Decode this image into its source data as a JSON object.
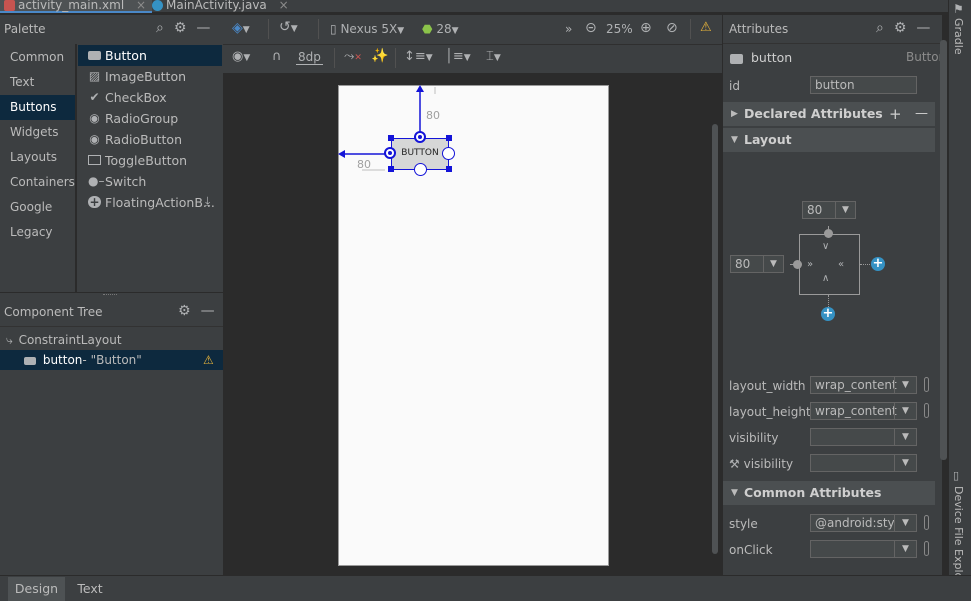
{
  "tabs": [
    {
      "label": "activity_main.xml",
      "close": "×"
    },
    {
      "label": "MainActivity.java",
      "close": "×"
    }
  ],
  "palette": {
    "title": "Palette",
    "categories": [
      "Common",
      "Text",
      "Buttons",
      "Widgets",
      "Layouts",
      "Containers",
      "Google",
      "Legacy"
    ],
    "selected_category": "Buttons",
    "widgets": [
      {
        "label": "Button",
        "icon": "button-icon"
      },
      {
        "label": "ImageButton",
        "icon": "image-icon"
      },
      {
        "label": "CheckBox",
        "icon": "check-icon"
      },
      {
        "label": "RadioGroup",
        "icon": "radio-icon"
      },
      {
        "label": "RadioButton",
        "icon": "radio-icon"
      },
      {
        "label": "ToggleButton",
        "icon": "toggle-icon"
      },
      {
        "label": "Switch",
        "icon": "switch-icon"
      },
      {
        "label": "FloatingActionB...",
        "icon": "fab-icon"
      }
    ]
  },
  "component_tree": {
    "title": "Component Tree",
    "root": "ConstraintLayout",
    "child_name": "button",
    "child_text": "- \"Button\""
  },
  "toolbar": {
    "device": "Nexus 5X",
    "api": "28",
    "zoom": "25%",
    "margin": "8dp"
  },
  "canvas": {
    "button_text": "BUTTON",
    "top_margin": "80",
    "left_margin": "80"
  },
  "attributes": {
    "title": "Attributes",
    "widget_name": "button",
    "widget_type": "Button",
    "id_label": "id",
    "id_value": "button",
    "declared_section": "Declared Attributes",
    "layout_section": "Layout",
    "inspector_top": "80",
    "inspector_left": "80",
    "rows": [
      {
        "label": "layout_width",
        "value": "wrap_content"
      },
      {
        "label": "layout_height",
        "value": "wrap_content"
      },
      {
        "label": "visibility",
        "value": ""
      },
      {
        "label": "visibility",
        "value": ""
      }
    ],
    "common_section": "Common Attributes",
    "common_rows": [
      {
        "label": "style",
        "value": "@android:sty"
      },
      {
        "label": "onClick",
        "value": ""
      }
    ]
  },
  "side_tools": {
    "gradle": "Gradle",
    "device_file_explorer": "Device File Explorer"
  },
  "bottom_tabs": [
    "Design",
    "Text"
  ],
  "colors": {
    "accent": "#4a88c7",
    "selection": "#0d293e",
    "constraint": "#1414d8",
    "warning": "#e8b43a"
  }
}
